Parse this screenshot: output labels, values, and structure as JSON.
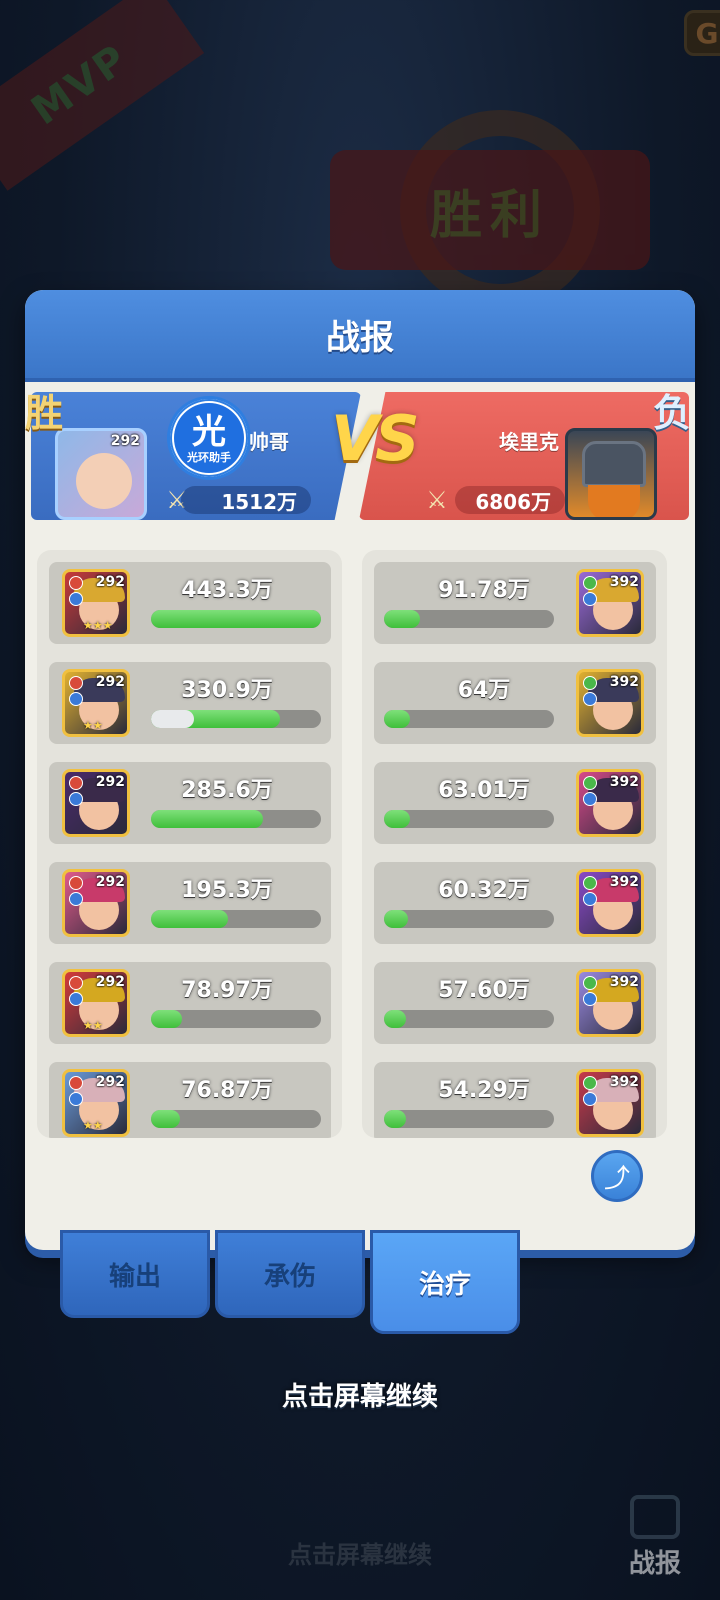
{
  "background": {
    "mvp_label": "MVP",
    "victory_label": "胜利",
    "continue_hint": "点击屏幕继续",
    "report_label": "战报",
    "corner_icon_text": "G"
  },
  "panel": {
    "title": "战报",
    "left_team": {
      "result": "胜",
      "leader_level": "292",
      "name": "帅哥",
      "power": "1512万",
      "helper_logo_char": "光",
      "helper_logo_text": "光环助手"
    },
    "vs_label": "VS",
    "right_team": {
      "result": "负",
      "name": "埃里克",
      "power": "6806万"
    },
    "left_heroes": [
      {
        "level": "292",
        "value": "443.3万",
        "fill": 1.0,
        "shield": 0,
        "stars": "★★★"
      },
      {
        "level": "292",
        "value": "330.9万",
        "fill": 0.76,
        "shield": 0.25,
        "stars": "★★"
      },
      {
        "level": "292",
        "value": "285.6万",
        "fill": 0.66,
        "shield": 0,
        "stars": ""
      },
      {
        "level": "292",
        "value": "195.3万",
        "fill": 0.45,
        "shield": 0,
        "stars": ""
      },
      {
        "level": "292",
        "value": "78.97万",
        "fill": 0.18,
        "shield": 0,
        "stars": "★★"
      },
      {
        "level": "292",
        "value": "76.87万",
        "fill": 0.17,
        "shield": 0,
        "stars": "★★"
      }
    ],
    "right_heroes": [
      {
        "level": "392",
        "value": "91.78万",
        "fill": 0.21
      },
      {
        "level": "392",
        "value": "64万",
        "fill": 0.15
      },
      {
        "level": "392",
        "value": "63.01万",
        "fill": 0.15
      },
      {
        "level": "392",
        "value": "60.32万",
        "fill": 0.14
      },
      {
        "level": "392",
        "value": "57.60万",
        "fill": 0.13
      },
      {
        "level": "392",
        "value": "54.29万",
        "fill": 0.13
      }
    ]
  },
  "tabs": [
    {
      "label": "输出",
      "active": false
    },
    {
      "label": "承伤",
      "active": false
    },
    {
      "label": "治疗",
      "active": true
    }
  ],
  "continue_text": "点击屏幕继续",
  "icons": {
    "share": "share-icon",
    "swords": "crossed-swords-icon"
  },
  "colors": {
    "panel_header": "#4a88dc",
    "left_team": "#4278cc",
    "right_team": "#e5605a",
    "bar_fill": "#4cc846",
    "vs": "#ffd54a"
  }
}
